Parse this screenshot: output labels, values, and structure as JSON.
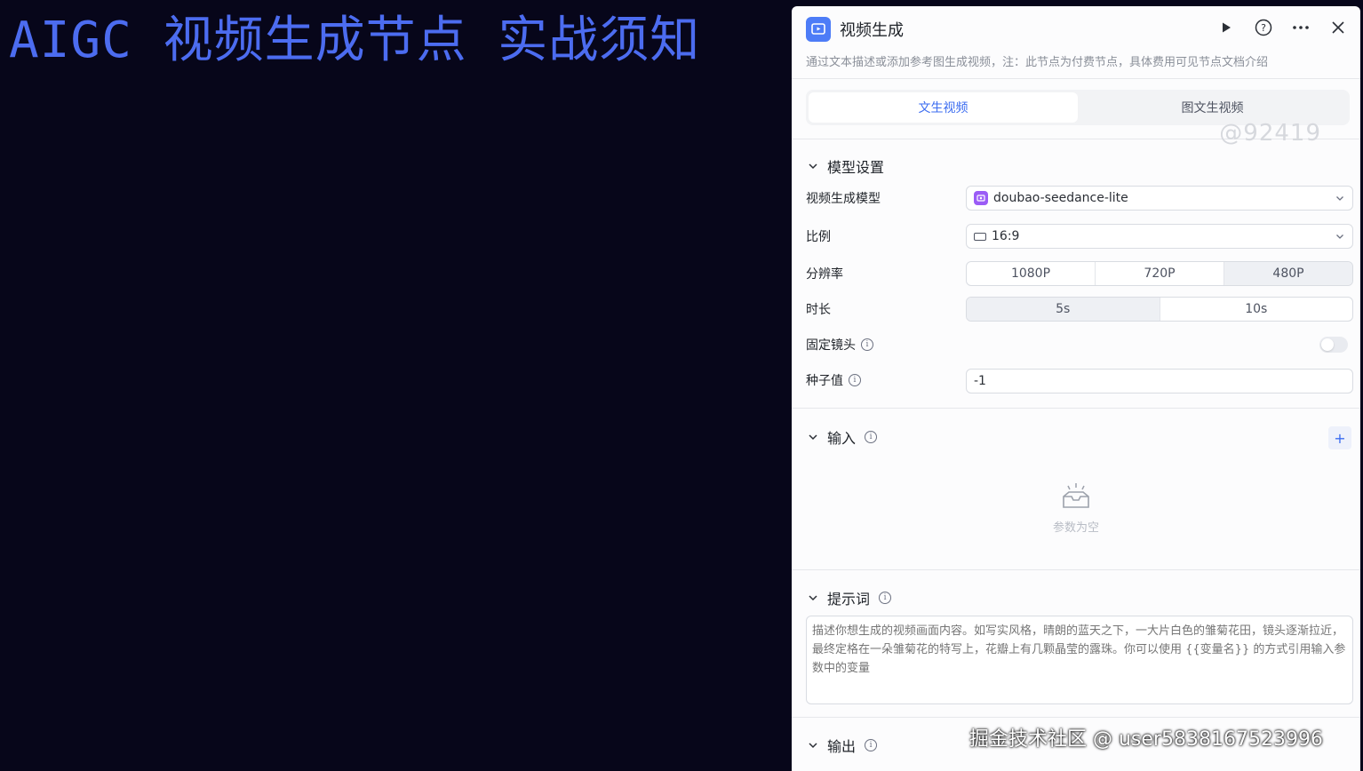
{
  "headline": "AIGC 视频生成节点 实战须知",
  "panel": {
    "title": "视频生成",
    "description": "通过文本描述或添加参考图生成视频，注：此节点为付费节点，具体费用可见节点文档介绍",
    "actions": [
      "play-icon",
      "help-icon",
      "more-icon",
      "close-icon"
    ]
  },
  "tabs": [
    {
      "label": "文生视频",
      "active": true
    },
    {
      "label": "图文生视频",
      "active": false
    }
  ],
  "watermark_id": "@92419",
  "model_settings": {
    "title": "模型设置",
    "model_label": "视频生成模型",
    "model_value": "doubao-seedance-lite",
    "ratio_label": "比例",
    "ratio_value": "16:9",
    "resolution_label": "分辨率",
    "resolution_options": [
      "1080P",
      "720P",
      "480P"
    ],
    "resolution_selected": "480P",
    "duration_label": "时长",
    "duration_options": [
      "5s",
      "10s"
    ],
    "duration_selected": "5s",
    "fixed_lens_label": "固定镜头",
    "fixed_lens_on": false,
    "seed_label": "种子值",
    "seed_value": "-1"
  },
  "input_section": {
    "title": "输入",
    "add_label": "+",
    "empty_text": "参数为空"
  },
  "prompt_section": {
    "title": "提示词",
    "placeholder": "描述你想生成的视频画面内容。如写实风格，晴朗的蓝天之下，一大片白色的雏菊花田，镜头逐渐拉近，最终定格在一朵雏菊花的特写上，花瓣上有几颗晶莹的露珠。你可以使用 {{变量名}} 的方式引用输入参数中的变量"
  },
  "output_section": {
    "title": "输出"
  },
  "footer_watermark": "掘金技术社区 @ user5838167523996",
  "colors": {
    "background": "#07061a",
    "headline": "#4c6cf0",
    "accent": "#3b6cf0",
    "node_icon": "#4d7cf7",
    "model_icon": "#9b5cf6"
  }
}
